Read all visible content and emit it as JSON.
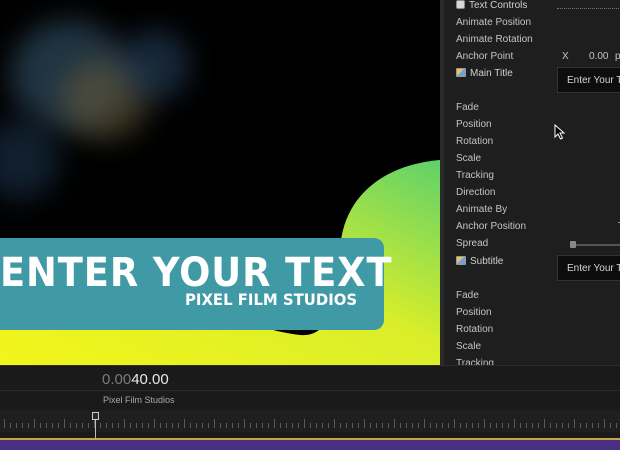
{
  "viewer": {
    "title_main": "ENTER YOUR TEXT",
    "title_sub": "PIXEL FILM STUDIOS"
  },
  "inspector": {
    "rows": [
      {
        "label": "Text Controls",
        "icon": "checkbox-icon"
      },
      {
        "label": "Animate Position"
      },
      {
        "label": "Animate Rotation"
      },
      {
        "label": "Anchor Point"
      },
      {
        "label": "Main Title",
        "icon": "image-icon"
      },
      {
        "label": "Fade"
      },
      {
        "label": "Position"
      },
      {
        "label": "Rotation"
      },
      {
        "label": "Scale"
      },
      {
        "label": "Tracking"
      },
      {
        "label": "Direction"
      },
      {
        "label": "Animate By"
      },
      {
        "label": "Anchor Position"
      },
      {
        "label": "Spread"
      },
      {
        "label": "Subtitle",
        "icon": "image-icon"
      },
      {
        "label": "Fade"
      },
      {
        "label": "Position"
      },
      {
        "label": "Rotation"
      },
      {
        "label": "Scale"
      },
      {
        "label": "Tracking"
      }
    ],
    "anchor_axis": "X",
    "anchor_value": "0.00",
    "anchor_unit": "px",
    "main_title_value": "Enter Your Te",
    "subtitle_value": "Enter Your Te",
    "anchor_position_value": "Ty"
  },
  "timeline": {
    "timecode_dim": "0.00",
    "timecode_bright": "40.00",
    "clip_name": "Pixel Film Studios"
  }
}
